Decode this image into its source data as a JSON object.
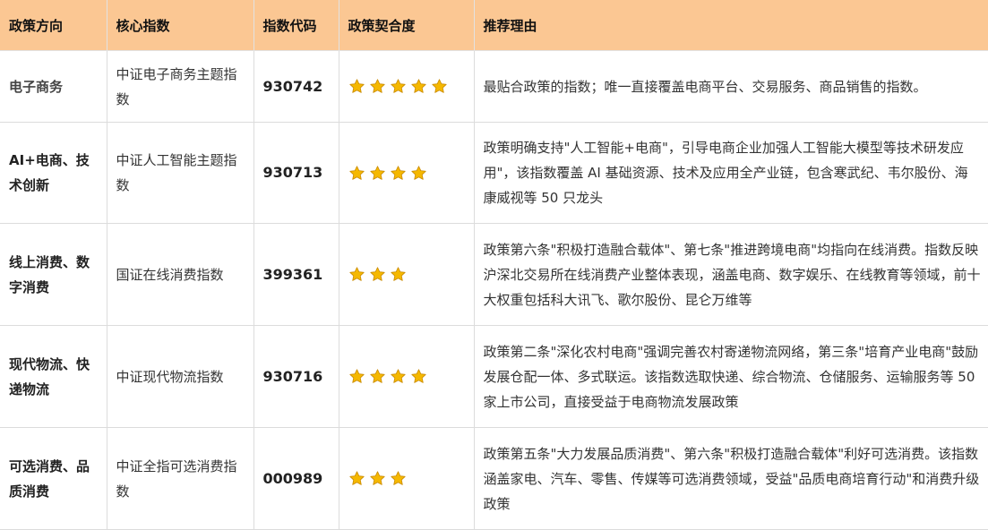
{
  "header": {
    "col_direction": "政策方向",
    "col_index": "核心指数",
    "col_code": "指数代码",
    "col_fit": "政策契合度",
    "col_reason": "推荐理由"
  },
  "rows": [
    {
      "direction": "电子商务",
      "index": "中证电子商务主题指数",
      "code": "930742",
      "stars": 5,
      "reason": "最贴合政策的指数；唯一直接覆盖电商平台、交易服务、商品销售的指数。"
    },
    {
      "direction": "AI+电商、技术创新",
      "index": "中证人工智能主题指数",
      "code": "930713",
      "stars": 4,
      "reason": "政策明确支持\"人工智能+电商\"，引导电商企业加强人工智能大模型等技术研发应用\"，该指数覆盖 AI 基础资源、技术及应用全产业链，包含寒武纪、韦尔股份、海康威视等 50 只龙头"
    },
    {
      "direction": "线上消费、数字消费",
      "index": "国证在线消费指数",
      "code": "399361",
      "stars": 3,
      "reason": "政策第六条\"积极打造融合载体\"、第七条\"推进跨境电商\"均指向在线消费。指数反映沪深北交易所在线消费产业整体表现，涵盖电商、数字娱乐、在线教育等领域，前十大权重包括科大讯飞、歌尔股份、昆仑万维等"
    },
    {
      "direction": "现代物流、快递物流",
      "index": "中证现代物流指数",
      "code": "930716",
      "stars": 4,
      "reason": "政策第二条\"深化农村电商\"强调完善农村寄递物流网络，第三条\"培育产业电商\"鼓励发展仓配一体、多式联运。该指数选取快递、综合物流、仓储服务、运输服务等 50 家上市公司，直接受益于电商物流发展政策"
    },
    {
      "direction": "可选消费、品质消费",
      "index": "中证全指可选消费指数",
      "code": "000989",
      "stars": 3,
      "reason": "政策第五条\"大力发展品质消费\"、第六条\"积极打造融合载体\"利好可选消费。该指数涵盖家电、汽车、零售、传媒等可选消费领域，受益\"品质电商培育行动\"和消费升级政策"
    }
  ],
  "colors": {
    "header_bg": "#fbc793",
    "star_fill": "#f5b800",
    "star_stroke": "#c98a00"
  },
  "icons": {
    "rating": "star-icon"
  }
}
